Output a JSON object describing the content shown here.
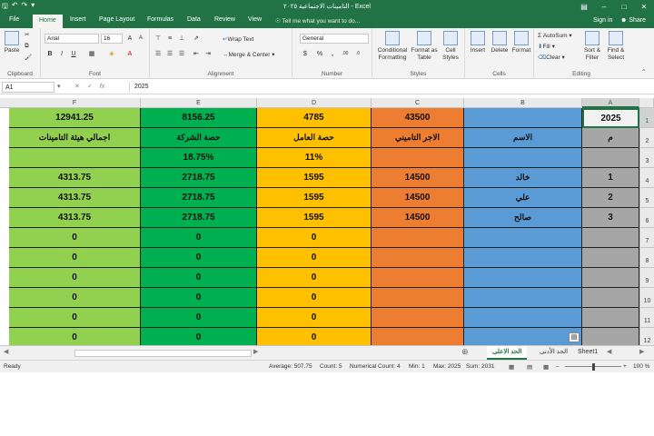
{
  "titlebar": {
    "title": "التامينات الاجتماعية ٢٠٢٥ - Excel",
    "qat_icons": [
      "save-icon",
      "undo-icon",
      "redo-icon",
      "customize-icon"
    ]
  },
  "tabs": [
    "File",
    "Home",
    "Insert",
    "Page Layout",
    "Formulas",
    "Data",
    "Review",
    "View"
  ],
  "active_tab": "Home",
  "tellme": "Tell me what you want to do...",
  "signin": "Sign in",
  "share": "Share",
  "ribbon": {
    "clipboard": {
      "paste": "Paste",
      "label": "Clipboard"
    },
    "font": {
      "name": "Arial",
      "size": "16",
      "bold": "B",
      "italic": "I",
      "underline": "U",
      "grow": "A",
      "shrink": "A",
      "label": "Font"
    },
    "alignment": {
      "wrap": "Wrap Text",
      "merge": "Merge & Center",
      "label": "Alignment"
    },
    "number": {
      "format": "General",
      "currency": "$",
      "percent": "%",
      "comma": ",",
      "label": "Number"
    },
    "styles": {
      "conditional": [
        "Conditional",
        "Formatting"
      ],
      "table": [
        "Format as",
        "Table"
      ],
      "cell": [
        "Cell",
        "Styles"
      ],
      "label": "Styles"
    },
    "cells": {
      "insert": "Insert",
      "delete": "Delete",
      "format": "Format",
      "label": "Cells"
    },
    "editing": {
      "autosum": "AutoSum",
      "fill": "Fill",
      "clear": "Clear",
      "sort": [
        "Sort &",
        "Filter"
      ],
      "find": [
        "Find &",
        "Select"
      ],
      "label": "Editing"
    }
  },
  "formula_bar": {
    "name_box": "A1",
    "fx": "fx",
    "value": "2025"
  },
  "columns": [
    "F",
    "E",
    "D",
    "C",
    "B",
    "A"
  ],
  "colors": {
    "F": "#92d050",
    "E": "#00b050",
    "D": "#ffc000",
    "C": "#ed7d31",
    "B": "#5b9bd5",
    "A": "#a6a6a6",
    "accent": "#217346"
  },
  "rows": [
    {
      "n": "1",
      "F": "12941.25",
      "E": "8156.25",
      "D": "4785",
      "C": "43500",
      "B": "",
      "A": "2025"
    },
    {
      "n": "2",
      "F": "اجمالي هيئة التامينات",
      "E": "حصة الشركة",
      "D": "حصة العامل",
      "C": "الاجر التاميني",
      "B": "الاسم",
      "A": "م"
    },
    {
      "n": "3",
      "F": "",
      "E": "18.75%",
      "D": "11%",
      "C": "",
      "B": "",
      "A": ""
    },
    {
      "n": "4",
      "F": "4313.75",
      "E": "2718.75",
      "D": "1595",
      "C": "14500",
      "B": "خالد",
      "A": "1"
    },
    {
      "n": "5",
      "F": "4313.75",
      "E": "2718.75",
      "D": "1595",
      "C": "14500",
      "B": "علي",
      "A": "2"
    },
    {
      "n": "6",
      "F": "4313.75",
      "E": "2718.75",
      "D": "1595",
      "C": "14500",
      "B": "صالح",
      "A": "3"
    },
    {
      "n": "7",
      "F": "0",
      "E": "0",
      "D": "0",
      "C": "",
      "B": "",
      "A": ""
    },
    {
      "n": "8",
      "F": "0",
      "E": "0",
      "D": "0",
      "C": "",
      "B": "",
      "A": ""
    },
    {
      "n": "9",
      "F": "0",
      "E": "0",
      "D": "0",
      "C": "",
      "B": "",
      "A": ""
    },
    {
      "n": "10",
      "F": "0",
      "E": "0",
      "D": "0",
      "C": "",
      "B": "",
      "A": ""
    },
    {
      "n": "11",
      "F": "0",
      "E": "0",
      "D": "0",
      "C": "",
      "B": "",
      "A": ""
    },
    {
      "n": "12",
      "F": "0",
      "E": "0",
      "D": "0",
      "C": "",
      "B": "",
      "A": ""
    }
  ],
  "sheets": [
    "الحد الاعلى",
    "الحد الأدنى",
    "Sheet1"
  ],
  "active_sheet": "الحد الاعلى",
  "statusbar": {
    "ready": "Ready",
    "average": "Average: 507.75",
    "count": "Count: 5",
    "numerical_count": "Numerical Count: 4",
    "min": "Min: 1",
    "max": "Max: 2025",
    "sum": "Sum: 2031",
    "zoom": "100 %"
  }
}
